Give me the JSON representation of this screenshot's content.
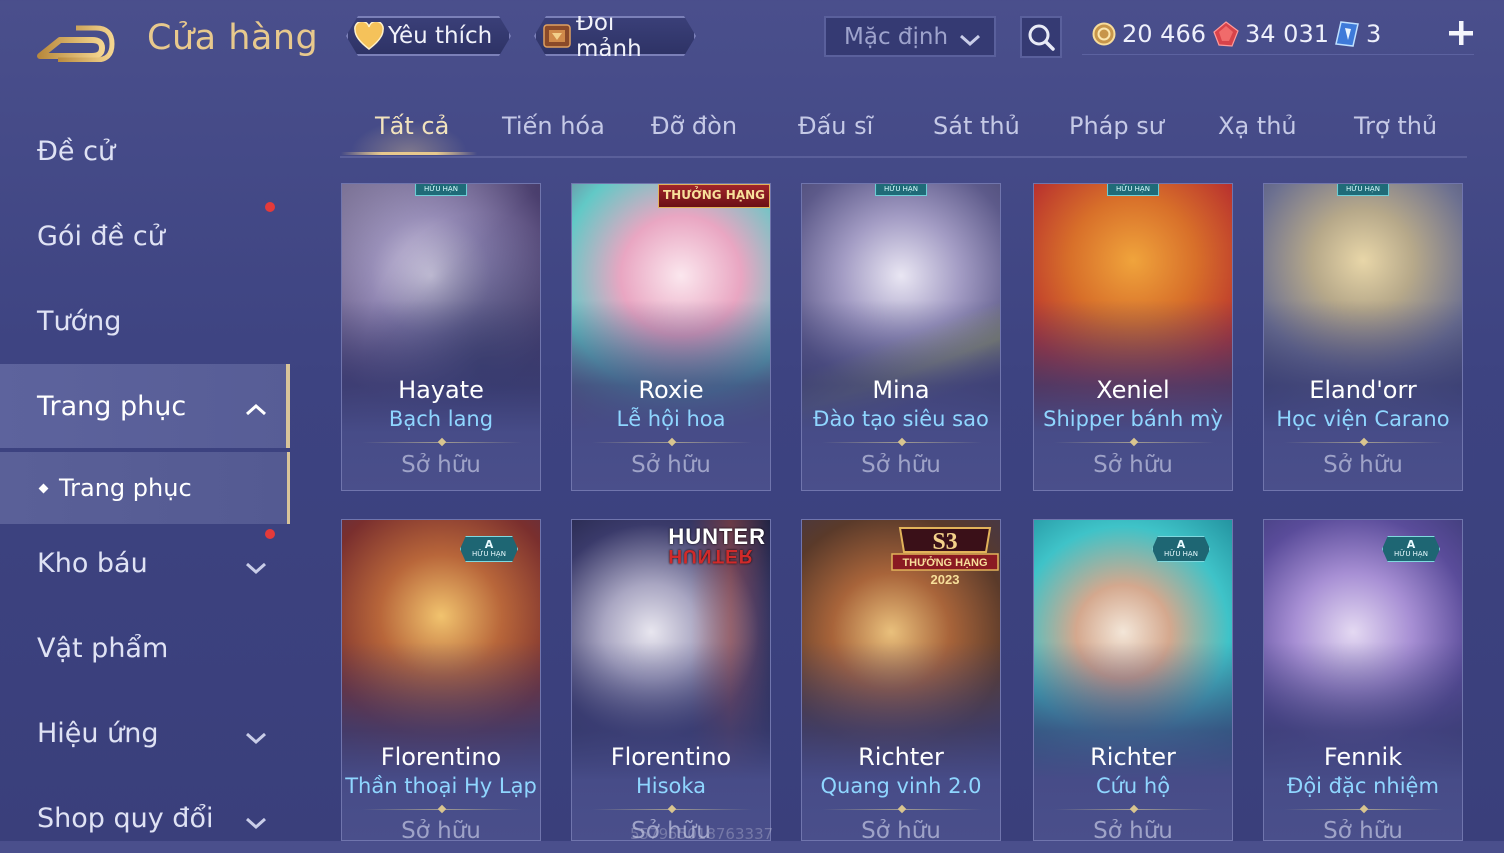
{
  "header": {
    "title": "Cửa hàng",
    "favorite_label": "Yêu thích",
    "exchange_label": "Đổi mảnh",
    "sort_value": "Mặc định",
    "currencies": [
      {
        "name": "gold-coin",
        "value": "20 466",
        "color": "#e8c98d"
      },
      {
        "name": "voucher",
        "value": "34 031",
        "color": "#e04848"
      },
      {
        "name": "diamond-ticket",
        "value": "3",
        "color": "#7fb6ff"
      }
    ]
  },
  "sidebar": {
    "items": [
      {
        "label": "Đề cử"
      },
      {
        "label": "Gói đề cử",
        "has_notification": true
      },
      {
        "label": "Tướng"
      },
      {
        "label": "Trang phục",
        "active": true,
        "expanded": true
      },
      {
        "label": "Kho báu",
        "has_notification": true
      },
      {
        "label": "Vật phẩm"
      },
      {
        "label": "Hiệu ứng"
      },
      {
        "label": "Shop quy đổi"
      }
    ],
    "sub_item": "Trang phục"
  },
  "tabs": [
    "Tất cả",
    "Tiến hóa",
    "Đỡ đòn",
    "Đấu sĩ",
    "Sát thủ",
    "Pháp sư",
    "Xạ thủ",
    "Trợ thủ"
  ],
  "active_tab": "Tất cả",
  "cards": [
    {
      "hero": "Hayate",
      "skin": "Bạch lang",
      "status": "Sở hữu",
      "badge": "HỮU HẠN"
    },
    {
      "hero": "Roxie",
      "skin": "Lễ hội hoa",
      "status": "Sở hữu",
      "badge": "THƯỞNG HẠNG"
    },
    {
      "hero": "Mina",
      "skin": "Đào tạo siêu sao",
      "status": "Sở hữu",
      "badge": "HỮU HẠN"
    },
    {
      "hero": "Xeniel",
      "skin": "Shipper bánh mỳ",
      "status": "Sở hữu",
      "badge": "HỮU HẠN"
    },
    {
      "hero": "Eland'orr",
      "skin": "Học viện Carano",
      "status": "Sở hữu",
      "badge": "HỮU HẠN"
    },
    {
      "hero": "Florentino",
      "skin": "Thần thoại Hy Lạp",
      "status": "Sở hữu",
      "badge": "A HỮU HẠN"
    },
    {
      "hero": "Florentino",
      "skin": "Hisoka",
      "status": "Sở hữu",
      "badge": "HUNTER×HUNTER"
    },
    {
      "hero": "Richter",
      "skin": "Quang vinh 2.0",
      "status": "Sở hữu",
      "badge": "S3 THƯỞNG HẠNG 2023"
    },
    {
      "hero": "Richter",
      "skin": "Cứu hộ",
      "status": "Sở hữu",
      "badge": "A HỮU HẠN"
    },
    {
      "hero": "Fennik",
      "skin": "Đội đặc nhiệm",
      "status": "Sở hữu",
      "badge": "A HỮU HẠN"
    }
  ],
  "badges": {
    "limited": "HỮU HẠN",
    "limited_a": "A",
    "rank": "THƯỞNG HẠNG",
    "s3": "S3",
    "s3_rank": "THƯỞNG HẠNG",
    "s3_year": "2023",
    "hunter_top": "HUNTER",
    "hunter_bottom": "HUNTER"
  },
  "watermark": "557955018763337"
}
